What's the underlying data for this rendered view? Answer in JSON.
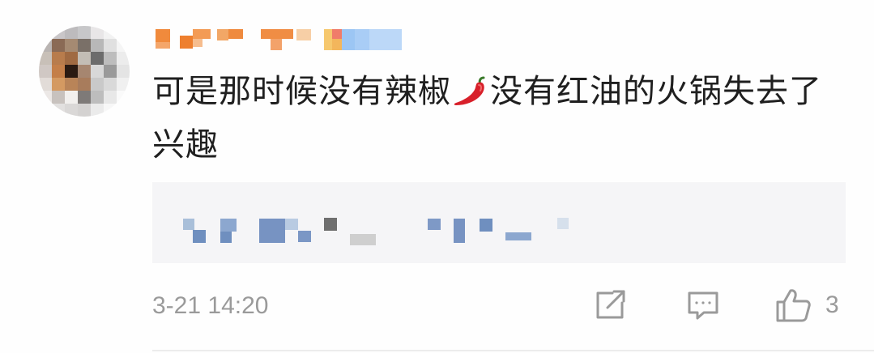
{
  "comment": {
    "text_before_emoji": "可是那时候没有辣椒",
    "emoji": "chili-pepper",
    "text_after_emoji": "没有红油的火锅失去了兴趣",
    "timestamp": "3-21 14:20",
    "like_count": "3"
  },
  "icons": {
    "share": "share-icon",
    "comment": "comment-icon",
    "like": "thumbs-up-icon"
  },
  "colors": {
    "text": "#1f1f1f",
    "meta": "#9a9a9a",
    "reply_background": "#f5f5f7",
    "chili_red": "#d8202a"
  }
}
